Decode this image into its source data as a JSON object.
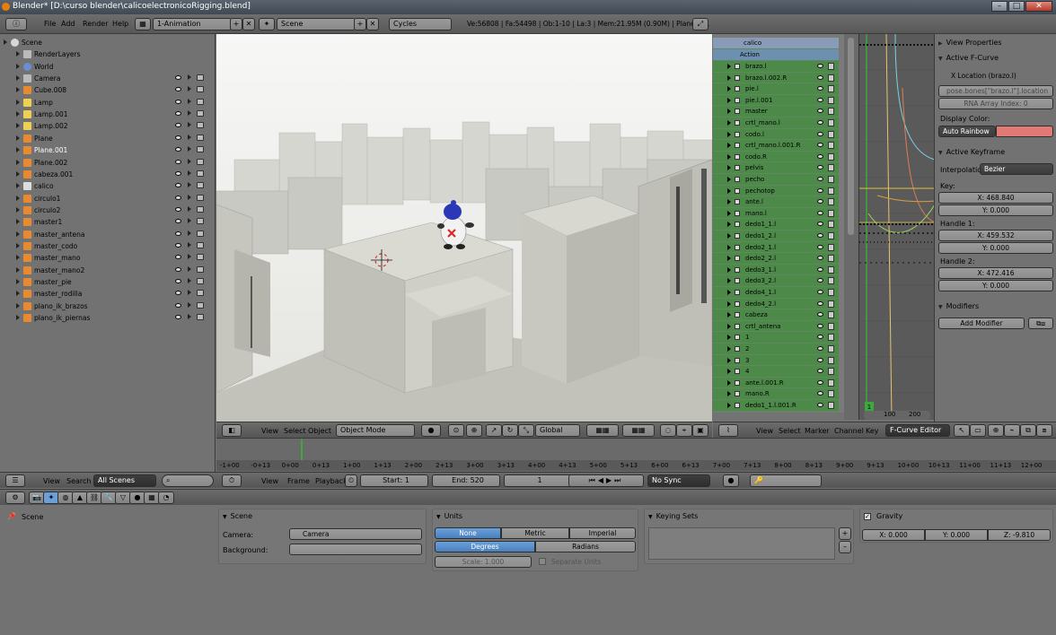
{
  "title_bar": {
    "title": "Blender* [D:\\curso blender\\calicoelectronicoRigging.blend]"
  },
  "info_header": {
    "menus": [
      "File",
      "Add",
      "Render",
      "Help"
    ],
    "screen_layout": "1-Animation",
    "scene": "Scene",
    "engine": "Cycles",
    "stats": "Ve:56808 | Fa:54498 | Ob:1-10 | La:3 | Mem:21.95M (0.90M) | Plane.001"
  },
  "outliner": {
    "items": [
      {
        "label": "Scene",
        "indent": 0,
        "icon": "scene-icon"
      },
      {
        "label": "RenderLayers",
        "indent": 1,
        "icon": "renderlayers-icon"
      },
      {
        "label": "World",
        "indent": 1,
        "icon": "world-icon"
      },
      {
        "label": "Camera",
        "indent": 1,
        "icon": "camera-icon"
      },
      {
        "label": "Cube.008",
        "indent": 1,
        "icon": "mesh-icon"
      },
      {
        "label": "Lamp",
        "indent": 1,
        "icon": "lamp-icon"
      },
      {
        "label": "Lamp.001",
        "indent": 1,
        "icon": "lamp-icon"
      },
      {
        "label": "Lamp.002",
        "indent": 1,
        "icon": "lamp-icon"
      },
      {
        "label": "Plane",
        "indent": 1,
        "icon": "mesh-icon"
      },
      {
        "label": "Plane.001",
        "indent": 1,
        "icon": "mesh-icon",
        "active": true
      },
      {
        "label": "Plane.002",
        "indent": 1,
        "icon": "mesh-icon"
      },
      {
        "label": "cabeza.001",
        "indent": 1,
        "icon": "mesh-icon"
      },
      {
        "label": "calico",
        "indent": 1,
        "icon": "armature-icon"
      },
      {
        "label": "circulo1",
        "indent": 1,
        "icon": "mesh-icon"
      },
      {
        "label": "circulo2",
        "indent": 1,
        "icon": "mesh-icon"
      },
      {
        "label": "master1",
        "indent": 1,
        "icon": "mesh-icon"
      },
      {
        "label": "master_antena",
        "indent": 1,
        "icon": "mesh-icon"
      },
      {
        "label": "master_codo",
        "indent": 1,
        "icon": "mesh-icon"
      },
      {
        "label": "master_mano",
        "indent": 1,
        "icon": "mesh-icon"
      },
      {
        "label": "master_mano2",
        "indent": 1,
        "icon": "mesh-icon"
      },
      {
        "label": "master_pie",
        "indent": 1,
        "icon": "mesh-icon"
      },
      {
        "label": "master_rodilla",
        "indent": 1,
        "icon": "mesh-icon"
      },
      {
        "label": "plano_ik_brazos",
        "indent": 1,
        "icon": "mesh-icon"
      },
      {
        "label": "plano_ik_piernas",
        "indent": 1,
        "icon": "mesh-icon"
      }
    ]
  },
  "viewport_header": {
    "menus": [
      "View",
      "Select",
      "Object"
    ],
    "mode": "Object Mode",
    "orientation": "Global"
  },
  "dopesheet": {
    "object": "calico",
    "action": "Action",
    "channels": [
      "brazo.l",
      "brazo.l.002.R",
      "pie.l",
      "pie.l.001",
      "master",
      "crtl_mano.l",
      "codo.l",
      "crtl_mano.l.001.R",
      "codo.R",
      "pelvis",
      "pecho",
      "pechotop",
      "ante.l",
      "mano.l",
      "dedo1_1.l",
      "dedo1_2.l",
      "dedo2_1.l",
      "dedo2_2.l",
      "dedo3_1.l",
      "dedo3_2.l",
      "dedo4_1.l",
      "dedo4_2.l",
      "cabeza",
      "crtl_antena",
      "1",
      "2",
      "3",
      "4",
      "ante.l.001.R",
      "mano.R",
      "dedo1_1.l.001.R"
    ]
  },
  "graph": {
    "axis_labels": [
      "4",
      "3",
      "2",
      "1",
      "0",
      "-1",
      "-2",
      "-3",
      "-4",
      "-5",
      "-6",
      "-7"
    ],
    "frame_labels": [
      "100",
      "200"
    ],
    "current": "1"
  },
  "graph_header": {
    "menus": [
      "View",
      "Select",
      "Marker",
      "Channel",
      "Key"
    ],
    "editor": "F-Curve Editor"
  },
  "props": {
    "view_properties": "View Properties",
    "active_fcurve": "Active F-Curve",
    "fcurve_name": "X Location (brazo.l)",
    "data_path": "pose.bones[\"brazo.l\"].location",
    "rna_index": "RNA Array Index: 0",
    "display_color_label": "Display Color:",
    "display_color": "Auto Rainbow",
    "swatch": "#e07a74",
    "active_keyframe": "Active Keyframe",
    "interp_label": "Interpolatio",
    "interp": "Bezier",
    "key_label": "Key:",
    "key_x": "X: 468.840",
    "key_y": "Y: 0.000",
    "h1_label": "Handle 1:",
    "h1_x": "X: 459.532",
    "h1_y": "Y: 0.000",
    "h2_label": "Handle 2:",
    "h2_x": "X: 472.416",
    "h2_y": "Y: 0.000",
    "modifiers": "Modifiers",
    "add_modifier": "Add Modifier"
  },
  "timeline": {
    "ticks": [
      "-1+00",
      "-0+13",
      "0+00",
      "0+13",
      "1+00",
      "1+13",
      "2+00",
      "2+13",
      "3+00",
      "3+13",
      "4+00",
      "4+13",
      "5+00",
      "5+13",
      "6+00",
      "6+13",
      "7+00",
      "7+13",
      "8+00",
      "8+13",
      "9+00",
      "9+13",
      "10+00",
      "10+13",
      "11+00",
      "11+13",
      "12+00"
    ]
  },
  "timeline_header": {
    "menus": [
      "View",
      "Frame",
      "Playback"
    ],
    "start": "Start: 1",
    "end": "End: 520",
    "current": "1",
    "sync": "No Sync"
  },
  "outliner_header": {
    "menus": [
      "View",
      "Search"
    ],
    "filter": "All Scenes"
  },
  "properties": {
    "breadcrumb": "Scene",
    "scene_panel": {
      "title": "Scene",
      "camera_label": "Camera:",
      "camera": "Camera",
      "background_label": "Background:"
    },
    "units_panel": {
      "title": "Units",
      "none": "None",
      "metric": "Metric",
      "imperial": "Imperial",
      "degrees": "Degrees",
      "radians": "Radians",
      "scale": "Scale: 1.000",
      "separate": "Separate Units"
    },
    "keying_panel": {
      "title": "Keying Sets"
    },
    "gravity_panel": {
      "title": "Gravity",
      "x": "X: 0.000",
      "y": "Y: 0.000",
      "z": "Z: -9.810"
    }
  }
}
